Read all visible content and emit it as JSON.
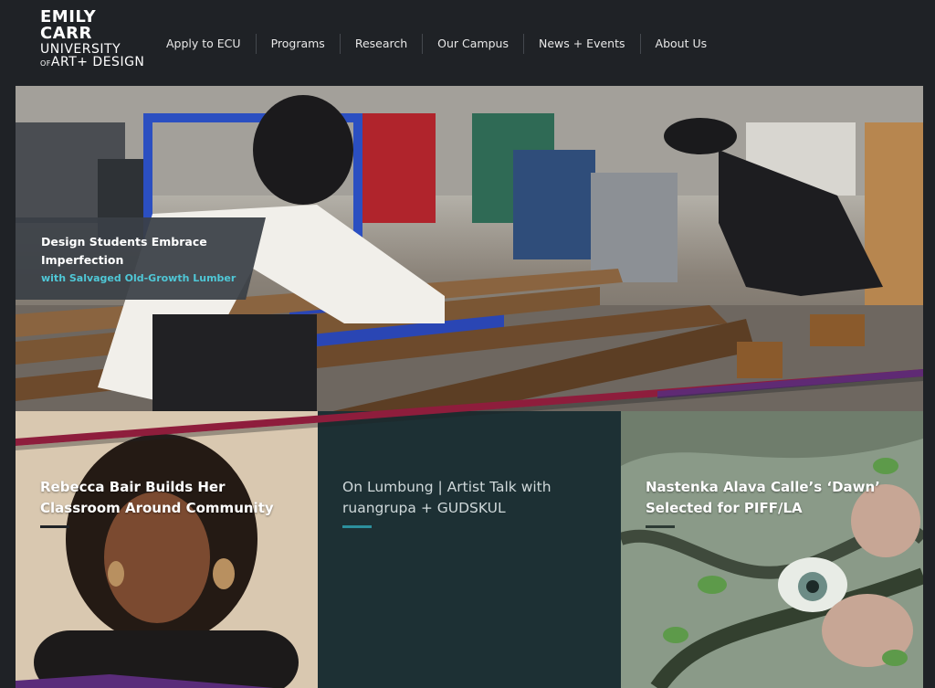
{
  "logo": {
    "line1": "EMILY",
    "line2": "CARR",
    "line3": "UNIVERSITY",
    "line4_small": "OF",
    "line4": "ART+ DESIGN"
  },
  "nav": {
    "items": [
      "Apply to ECU",
      "Programs",
      "Research",
      "Our Campus",
      "News + Events",
      "About Us"
    ]
  },
  "hero": {
    "title": "Design Students Embrace Imperfection",
    "subtitle": "with Salvaged Old-Growth Lumber",
    "accent_color": "#4fc7d6"
  },
  "tiles": [
    {
      "title": "Rebecca Bair Builds Her Classroom Around Community",
      "bar_color": "#1f2226"
    },
    {
      "title": "On Lumbung | Artist Talk with ruangrupa + GUDSKUL",
      "bar_color": "#2c8f9c"
    },
    {
      "title": "Nastenka Alava Calle’s ‘Dawn’ Selected for PIFF/LA",
      "bar_color": "#2c3a34"
    }
  ],
  "colors": {
    "background": "#1f2226",
    "stripe_red": "#8e1d3c",
    "stripe_purple": "#5a2c7a"
  }
}
